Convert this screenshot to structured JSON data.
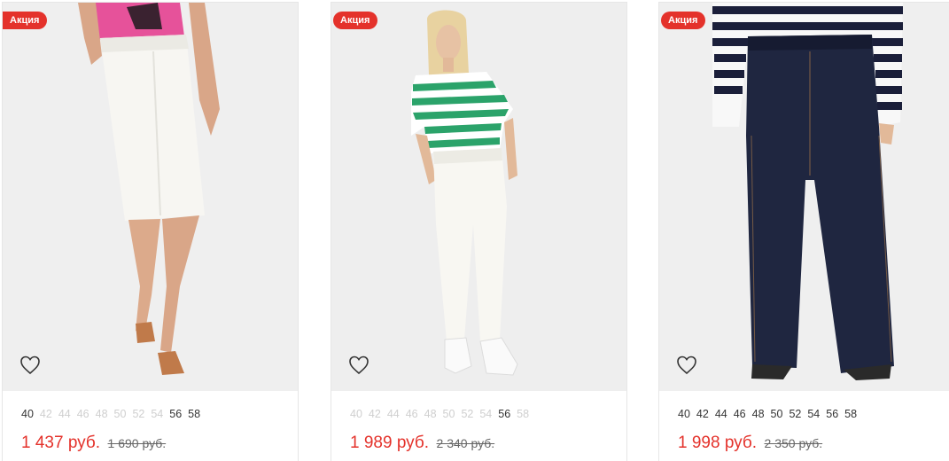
{
  "products": [
    {
      "badge": "Акция",
      "sizes": [
        {
          "label": "40",
          "available": true
        },
        {
          "label": "42",
          "available": false
        },
        {
          "label": "44",
          "available": false
        },
        {
          "label": "46",
          "available": false
        },
        {
          "label": "48",
          "available": false
        },
        {
          "label": "50",
          "available": false
        },
        {
          "label": "52",
          "available": false
        },
        {
          "label": "54",
          "available": false
        },
        {
          "label": "56",
          "available": true
        },
        {
          "label": "58",
          "available": true
        }
      ],
      "price": "1 437 руб.",
      "old_price": "1 690 руб."
    },
    {
      "badge": "Акция",
      "sizes": [
        {
          "label": "40",
          "available": false
        },
        {
          "label": "42",
          "available": false
        },
        {
          "label": "44",
          "available": false
        },
        {
          "label": "46",
          "available": false
        },
        {
          "label": "48",
          "available": false
        },
        {
          "label": "50",
          "available": false
        },
        {
          "label": "52",
          "available": false
        },
        {
          "label": "54",
          "available": false
        },
        {
          "label": "56",
          "available": true
        },
        {
          "label": "58",
          "available": false
        }
      ],
      "price": "1 989 руб.",
      "old_price": "2 340 руб."
    },
    {
      "badge": "Акция",
      "sizes": [
        {
          "label": "40",
          "available": true
        },
        {
          "label": "42",
          "available": true
        },
        {
          "label": "44",
          "available": true
        },
        {
          "label": "46",
          "available": true
        },
        {
          "label": "48",
          "available": true
        },
        {
          "label": "50",
          "available": true
        },
        {
          "label": "52",
          "available": true
        },
        {
          "label": "54",
          "available": true
        },
        {
          "label": "56",
          "available": true
        },
        {
          "label": "58",
          "available": true
        }
      ],
      "price": "1 998 руб.",
      "old_price": "2 350 руб."
    }
  ],
  "icons": {
    "favorite": "heart-outline-icon"
  },
  "colors": {
    "accent": "#e4322b",
    "size_available": "#333333",
    "size_unavailable": "#cfcfcf",
    "photo_background": "#f0f0f0"
  }
}
